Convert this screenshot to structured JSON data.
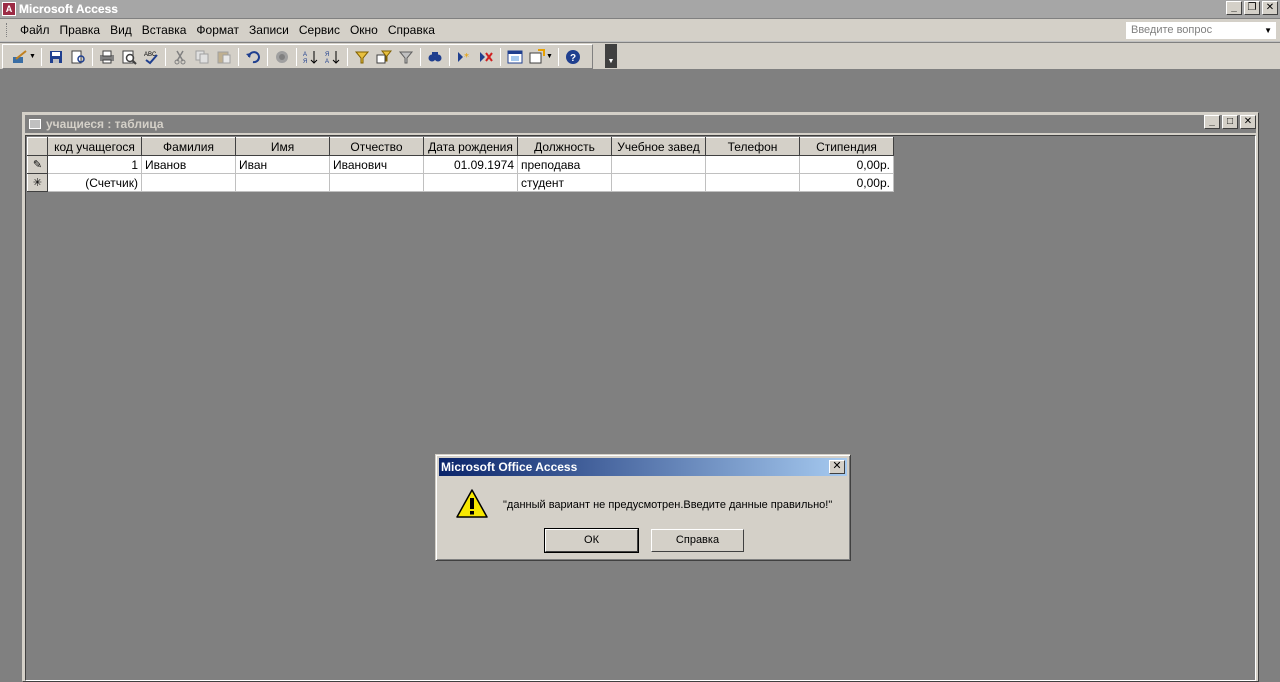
{
  "app": {
    "title": "Microsoft Access",
    "logo": "A"
  },
  "menu": {
    "items": [
      "Файл",
      "Правка",
      "Вид",
      "Вставка",
      "Формат",
      "Записи",
      "Сервис",
      "Окно",
      "Справка"
    ],
    "ask_placeholder": "Введите вопрос"
  },
  "toolbar": {
    "icons": [
      "view-icon",
      "save-icon",
      "search-file-icon",
      "print-icon",
      "print-preview-icon",
      "spelling-icon",
      "cut-icon",
      "copy-icon",
      "paste-icon",
      "undo-icon",
      "hyperlink-icon",
      "sort-ascending-icon",
      "sort-descending-icon",
      "filter-by-selection-icon",
      "filter-by-form-icon",
      "apply-filter-icon",
      "find-icon",
      "new-record-icon",
      "delete-record-icon",
      "database-window-icon",
      "new-object-icon",
      "help-icon"
    ]
  },
  "table_window": {
    "title": "учащиеся : таблица",
    "columns": [
      "код учащегося",
      "Фамилия",
      "Имя",
      "Отчество",
      "Дата рождения",
      "Должность",
      "Учебное завед",
      "Телефон",
      "Стипендия"
    ],
    "rows": [
      {
        "selector": "✎",
        "cells": [
          "1",
          "Иванов",
          "Иван",
          "Иванович",
          "01.09.1974",
          "преподава",
          "",
          "",
          "0,00р."
        ]
      },
      {
        "selector": "✳",
        "cells": [
          "(Счетчик)",
          "",
          "",
          "",
          "",
          "студент",
          "",
          "",
          "0,00р."
        ]
      }
    ]
  },
  "dialog": {
    "title": "Microsoft Office Access",
    "message": "\"данный вариант не предусмотрен.Введите данные правильно!\"",
    "ok_label": "ОК",
    "help_label": "Справка",
    "close_glyph": "✕"
  }
}
